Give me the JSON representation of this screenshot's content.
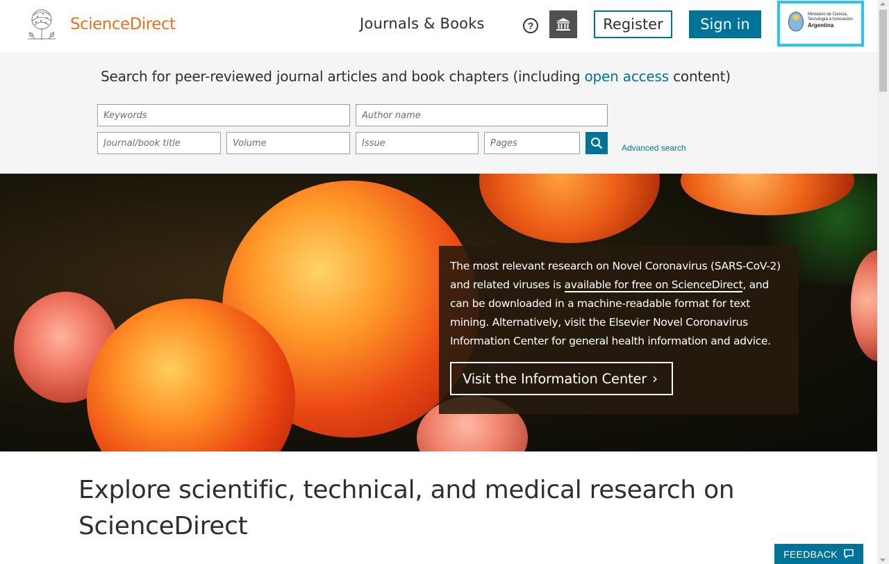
{
  "header": {
    "brand": "ScienceDirect",
    "nav_journals": "Journals & Books",
    "help_icon": "question-circle-icon",
    "institution_icon": "institution-building-icon",
    "register_label": "Register",
    "signin_label": "Sign in",
    "institution_logo": {
      "line1": "Ministerio de Ciencia,",
      "line2": "Tecnología e Innovación",
      "line3": "Argentina"
    }
  },
  "search": {
    "tagline_before": "Search for peer-reviewed journal articles and book chapters (including ",
    "tagline_link": "open access",
    "tagline_after": " content)",
    "keywords_placeholder": "Keywords",
    "author_placeholder": "Author name",
    "journal_placeholder": "Journal/book title",
    "volume_placeholder": "Volume",
    "issue_placeholder": "Issue",
    "pages_placeholder": "Pages",
    "search_icon": "search-icon",
    "advanced_label": "Advanced search"
  },
  "hero": {
    "info_before_link": "The most relevant research on Novel Coronavirus (SARS-CoV-2) and related viruses is ",
    "info_link": "available for free on ScienceDirect",
    "info_after_link": ", and can be downloaded in a machine-readable format for text mining. Alternatively, visit the Elsevier Novel Coronavirus Information Center for general health information and advice.",
    "visit_label": "Visit the Information Center",
    "visit_icon": "chevron-right-icon"
  },
  "explore": {
    "heading": "Explore scientific, technical, and medical research on ScienceDirect"
  },
  "feedback": {
    "label": "FEEDBACK",
    "icon": "speech-bubble-icon"
  },
  "colors": {
    "brand_orange": "#e9711c",
    "accent_blue": "#007398",
    "highlight_cyan": "#29c4f0"
  }
}
